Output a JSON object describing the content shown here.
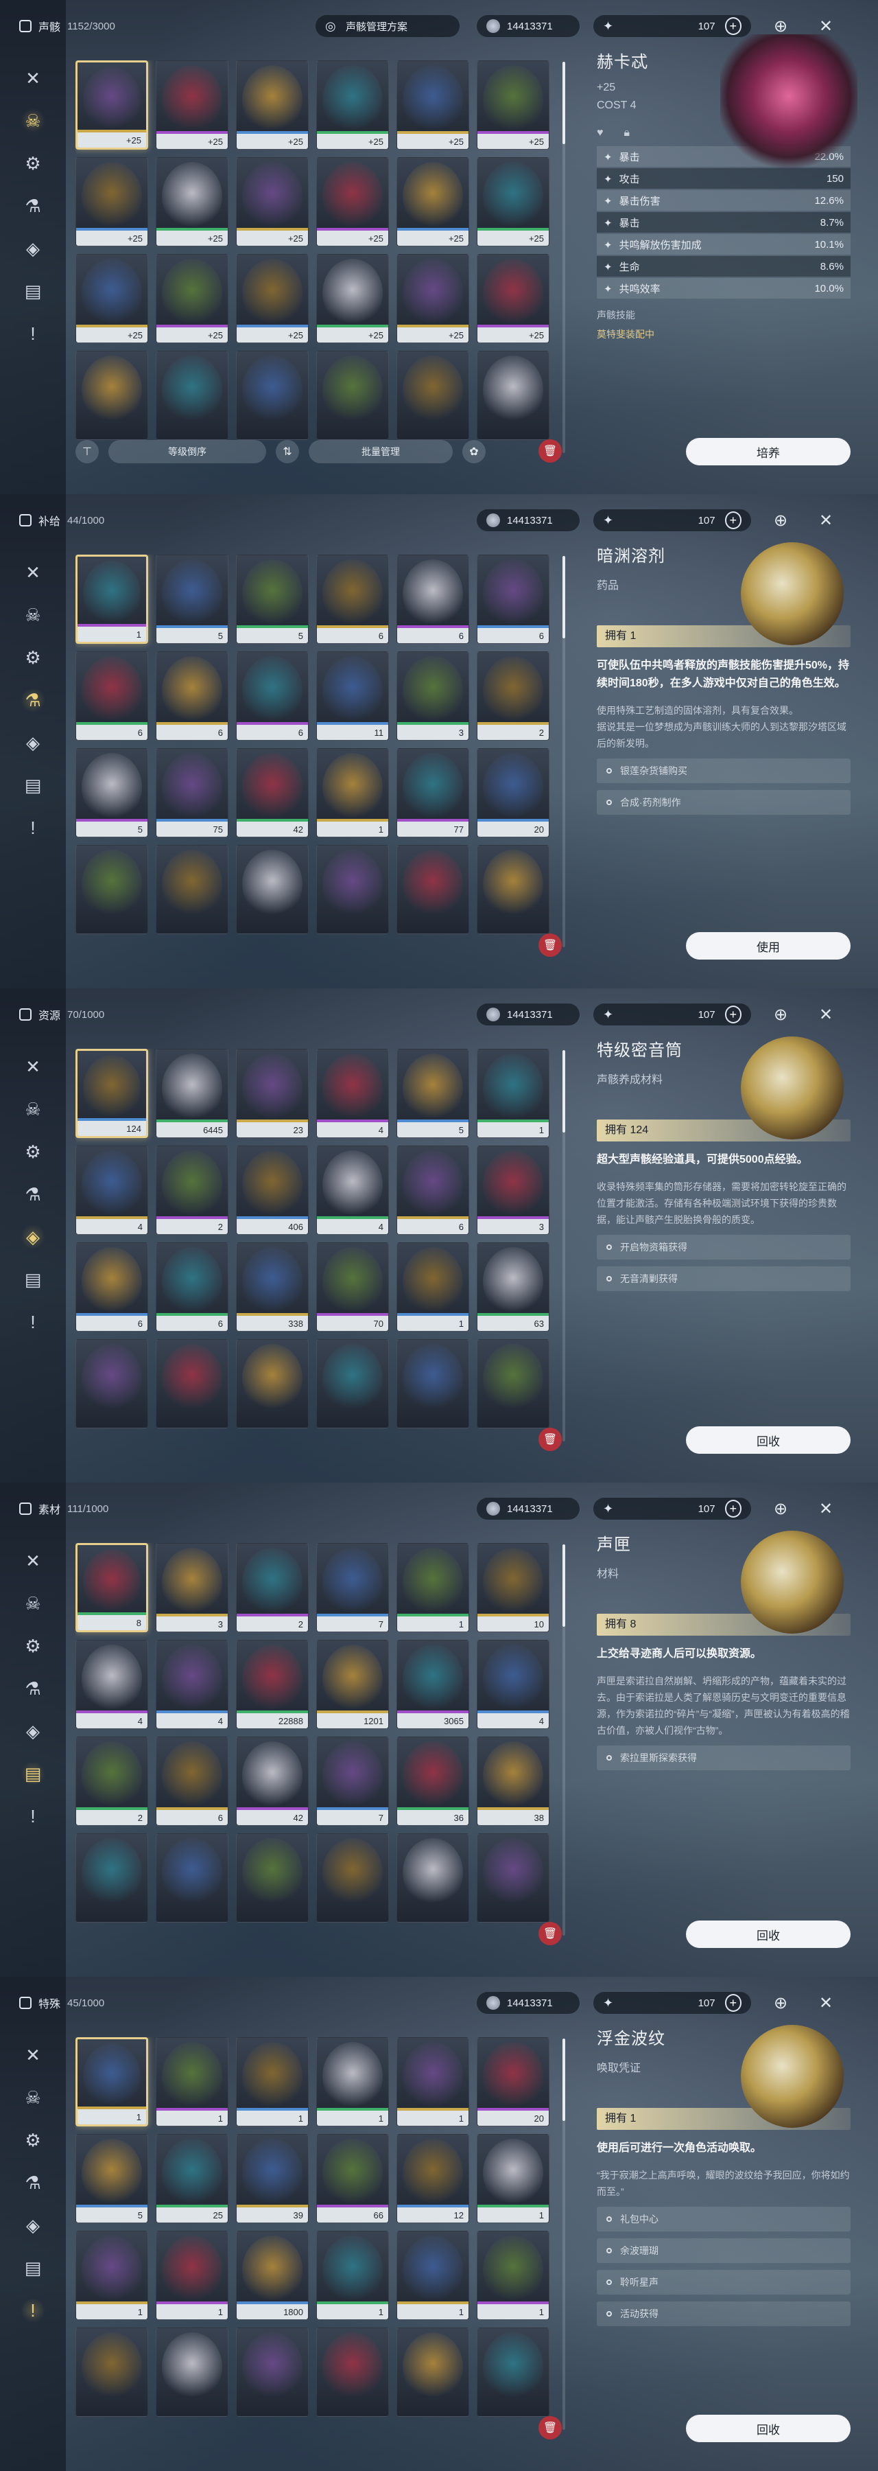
{
  "currency": "14413371",
  "moon_value": "107",
  "panels": [
    {
      "id": "echoes",
      "title": "声骸",
      "count": "1152/3000",
      "top_mid": "声骸管理方案",
      "active_nav": 1,
      "cells": [
        {
          "n": "4",
          "b": "+25",
          "sel": true
        },
        {
          "n": "4",
          "b": "+25"
        },
        {
          "n": "4",
          "b": "+25"
        },
        {
          "n": "4",
          "b": "+25"
        },
        {
          "n": "4",
          "b": "+25"
        },
        {
          "n": "4",
          "b": "+25"
        },
        {
          "n": "4",
          "b": "+25"
        },
        {
          "n": "4",
          "b": "+25"
        },
        {
          "n": "4",
          "b": "+25"
        },
        {
          "n": "4",
          "b": "+25"
        },
        {
          "n": "4",
          "b": "+25"
        },
        {
          "n": "4",
          "b": "+25"
        },
        {
          "n": "3",
          "b": "+25"
        },
        {
          "n": "3",
          "b": "+25"
        },
        {
          "n": "3",
          "b": "+25"
        },
        {
          "n": "3",
          "b": "+25"
        },
        {
          "n": "3",
          "b": "+25"
        },
        {
          "n": "3",
          "b": "+25"
        },
        {
          "n": "",
          "b": ""
        },
        {
          "n": "",
          "b": ""
        },
        {
          "n": "",
          "b": ""
        },
        {
          "n": "",
          "b": ""
        },
        {
          "n": "",
          "b": ""
        },
        {
          "n": "",
          "b": ""
        }
      ],
      "detail": {
        "name": "赫卡忒",
        "level": "+25",
        "cost": "COST  4",
        "stats": [
          {
            "k": "暴击",
            "v": "22.0%"
          },
          {
            "k": "攻击",
            "v": "150"
          },
          {
            "k": "暴击伤害",
            "v": "12.6%"
          },
          {
            "k": "暴击",
            "v": "8.7%"
          },
          {
            "k": "共鸣解放伤害加成",
            "v": "10.1%"
          },
          {
            "k": "生命",
            "v": "8.6%"
          },
          {
            "k": "共鸣效率",
            "v": "10.0%"
          }
        ],
        "skill_label": "声骸技能",
        "equip": "莫特斐装配中"
      },
      "bottom": {
        "sort": "等级倒序",
        "batch": "批量管理"
      },
      "button": "培养"
    },
    {
      "id": "supplies",
      "title": "补给",
      "count": "44/1000",
      "active_nav": 3,
      "cells": [
        {
          "n": "1",
          "sel": true
        },
        {
          "n": "5"
        },
        {
          "n": "5"
        },
        {
          "n": "6"
        },
        {
          "n": "6"
        },
        {
          "n": "6"
        },
        {
          "n": "6"
        },
        {
          "n": "6"
        },
        {
          "n": "6"
        },
        {
          "n": "11"
        },
        {
          "n": "3"
        },
        {
          "n": "2"
        },
        {
          "n": "5"
        },
        {
          "n": "75"
        },
        {
          "n": "42"
        },
        {
          "n": "1"
        },
        {
          "n": "77"
        },
        {
          "n": "20"
        },
        {
          "n": ""
        },
        {
          "n": ""
        },
        {
          "n": ""
        },
        {
          "n": ""
        },
        {
          "n": ""
        },
        {
          "n": ""
        }
      ],
      "detail": {
        "name": "暗渊溶剂",
        "sub": "药品",
        "own": "拥有 1",
        "hl": "可使队伍中共鸣者释放的声骸技能伤害提升50%，持续时间180秒，在多人游戏中仅对自己的角色生效。",
        "desc": "使用特殊工艺制造的固体溶剂，具有复合效果。\n据说其是一位梦想成为声骸训练大师的人到达黎那汐塔区域后的新发明。",
        "sources": [
          "银莲杂货铺购买",
          "合成·药剂制作"
        ]
      },
      "button": "使用"
    },
    {
      "id": "resources",
      "title": "资源",
      "count": "70/1000",
      "active_nav": 4,
      "cells": [
        {
          "n": "124",
          "sel": true
        },
        {
          "n": "6445"
        },
        {
          "n": "23"
        },
        {
          "n": "4"
        },
        {
          "n": "5"
        },
        {
          "n": "1"
        },
        {
          "n": "4"
        },
        {
          "n": "2"
        },
        {
          "n": "406"
        },
        {
          "n": "4"
        },
        {
          "n": "6"
        },
        {
          "n": "3"
        },
        {
          "n": "6"
        },
        {
          "n": "6"
        },
        {
          "n": "338"
        },
        {
          "n": "70"
        },
        {
          "n": "1"
        },
        {
          "n": "63"
        },
        {
          "n": ""
        },
        {
          "n": ""
        },
        {
          "n": ""
        },
        {
          "n": ""
        },
        {
          "n": ""
        },
        {
          "n": ""
        }
      ],
      "detail": {
        "name": "特级密音筒",
        "sub": "声骸养成材料",
        "own": "拥有 124",
        "hl": "超大型声骸经验道具，可提供5000点经验。",
        "desc": "收录特殊频率集的筒形存储器，需要将加密转轮旋至正确的位置才能激活。存储有各种极端测试环境下获得的珍贵数据，能让声骸产生脱胎换骨般的质变。",
        "sources": [
          "开启物资箱获得",
          "无音清剿获得"
        ]
      },
      "button": "回收"
    },
    {
      "id": "materials",
      "title": "素材",
      "count": "111/1000",
      "active_nav": 5,
      "cells": [
        {
          "n": "8",
          "sel": true
        },
        {
          "n": "3"
        },
        {
          "n": "2"
        },
        {
          "n": "7"
        },
        {
          "n": "1"
        },
        {
          "n": "10"
        },
        {
          "n": "4"
        },
        {
          "n": "4"
        },
        {
          "n": "22888"
        },
        {
          "n": "1201"
        },
        {
          "n": "3065"
        },
        {
          "n": "4"
        },
        {
          "n": "2"
        },
        {
          "n": "6"
        },
        {
          "n": "42"
        },
        {
          "n": "7"
        },
        {
          "n": "36"
        },
        {
          "n": "38"
        },
        {
          "n": ""
        },
        {
          "n": ""
        },
        {
          "n": ""
        },
        {
          "n": ""
        },
        {
          "n": ""
        },
        {
          "n": ""
        }
      ],
      "detail": {
        "name": "声匣",
        "sub": "材料",
        "own": "拥有 8",
        "hl": "上交给寻迹商人后可以换取资源。",
        "desc": "声匣是索诺拉自然崩解、坍缩形成的产物，蕴藏着未实的过去。由于索诺拉是人类了解恩骑历史与文明变迁的重要信息源，作为索诺拉的“碎片”与“凝缩”，声匣被认为有着极高的稽古价值，亦被人们视作“古物”。",
        "sources": [
          "索拉里斯探索获得"
        ]
      },
      "button": "回收"
    },
    {
      "id": "special",
      "title": "特殊",
      "count": "45/1000",
      "active_nav": 6,
      "cells": [
        {
          "n": "1",
          "sel": true
        },
        {
          "n": "1"
        },
        {
          "n": "1"
        },
        {
          "n": "1"
        },
        {
          "n": "1"
        },
        {
          "n": "20"
        },
        {
          "n": "5"
        },
        {
          "n": "25"
        },
        {
          "n": "39"
        },
        {
          "n": "66"
        },
        {
          "n": "12"
        },
        {
          "n": "1"
        },
        {
          "n": "1"
        },
        {
          "n": "1"
        },
        {
          "n": "1800"
        },
        {
          "n": "1"
        },
        {
          "n": "1"
        },
        {
          "n": "1"
        },
        {
          "n": ""
        },
        {
          "n": ""
        },
        {
          "n": ""
        },
        {
          "n": ""
        },
        {
          "n": ""
        },
        {
          "n": ""
        }
      ],
      "detail": {
        "name": "浮金波纹",
        "sub": "唤取凭证",
        "own": "拥有 1",
        "hl": "使用后可进行一次角色活动唤取。",
        "desc": "“我于寂潮之上高声呼唤，耀眼的波纹给予我回应，你将如约而至。”",
        "sources": [
          "礼包中心",
          "余波珊瑚",
          "聆听星声",
          "活动获得"
        ]
      },
      "button": "回收"
    }
  ],
  "nav_icons": [
    "sword-icon",
    "echo-mask-icon",
    "ring-icon",
    "supply-icon",
    "resource-icon",
    "material-icon",
    "special-icon"
  ],
  "art_colors": [
    "#6b4b8c",
    "#2f7a8a",
    "#8a6b2f",
    "#9a3346",
    "#3f5f9a",
    "#c9c9d2",
    "#b38a3a",
    "#5a7a3a"
  ]
}
